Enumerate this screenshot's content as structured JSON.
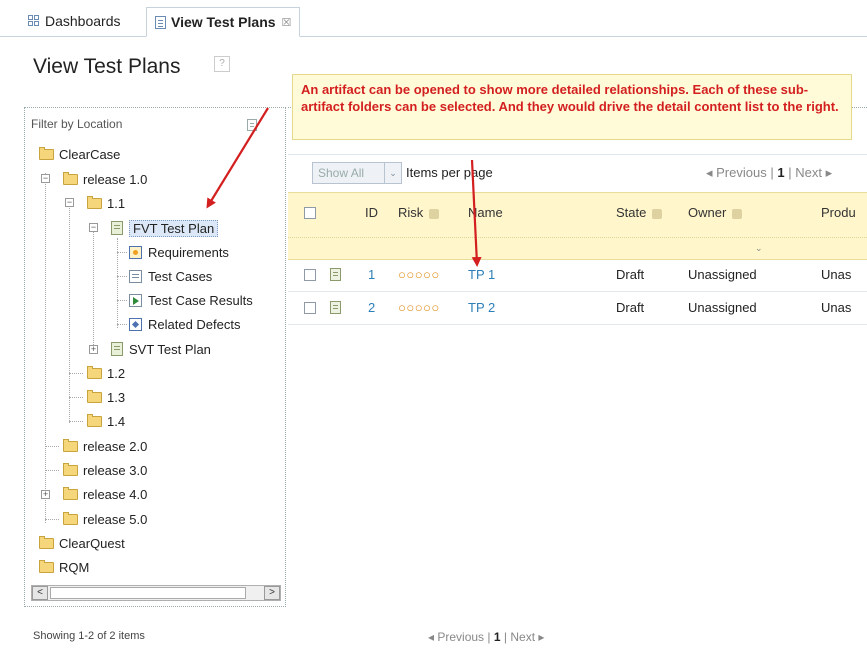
{
  "tabs": [
    {
      "label": "Dashboards",
      "icon": "grid-icon"
    },
    {
      "label": "View Test Plans",
      "icon": "list-icon",
      "close": "☒"
    }
  ],
  "page": {
    "title": "View Test Plans",
    "help": "?"
  },
  "callout": {
    "text": "An artifact can be opened to show more detailed relationships. Each of these sub-artifact folders can be selected. And they would drive the detail content list to the right."
  },
  "tree": {
    "filter_label": "Filter by Location",
    "items": [
      {
        "label": "ClearCase"
      },
      {
        "label": "release 1.0",
        "toggle": "−"
      },
      {
        "label": "1.1",
        "toggle": "−"
      },
      {
        "label": "FVT Test Plan",
        "toggle": "−"
      },
      {
        "label": "Requirements"
      },
      {
        "label": "Test Cases"
      },
      {
        "label": "Test Case Results"
      },
      {
        "label": "Related Defects"
      },
      {
        "label": "SVT Test Plan",
        "toggle": "+"
      },
      {
        "label": "1.2"
      },
      {
        "label": "1.3"
      },
      {
        "label": "1.4"
      },
      {
        "label": "release 2.0"
      },
      {
        "label": "release 3.0"
      },
      {
        "label": "release 4.0",
        "toggle": "+"
      },
      {
        "label": "release 5.0"
      },
      {
        "label": "ClearQuest"
      },
      {
        "label": "RQM"
      }
    ],
    "scroll_left": "<",
    "scroll_right": ">"
  },
  "toolbar": {
    "show_all": "Show All",
    "dropdown_arrow": "⌄",
    "items_per_page": "Items per page",
    "pager": {
      "prev": "◂ Previous",
      "sep1": "|",
      "page": "1",
      "sep2": "|",
      "next": "Next ▸"
    }
  },
  "table": {
    "headers": {
      "id": "ID",
      "risk": "Risk",
      "name": "Name",
      "state": "State",
      "owner": "Owner",
      "product": "Produ"
    },
    "filter_chevron": "⌄",
    "rows": [
      {
        "id": "1",
        "risk": "○○○○○",
        "name": "TP 1",
        "state": "Draft",
        "owner": "Unassigned",
        "product": "Unas"
      },
      {
        "id": "2",
        "risk": "○○○○○",
        "name": "TP 2",
        "state": "Draft",
        "owner": "Unassigned",
        "product": "Unas"
      }
    ]
  },
  "footer": {
    "showing": "Showing 1-2 of 2 items",
    "pager": {
      "prev": "◂ Previous",
      "sep1": "|",
      "page": "1",
      "sep2": "|",
      "next": "Next ▸"
    }
  },
  "colors": {
    "annotation": "#d31f1f",
    "callout_bg": "#fffbd9",
    "header_bg": "#fff6cc",
    "link": "#2d7fb8"
  }
}
